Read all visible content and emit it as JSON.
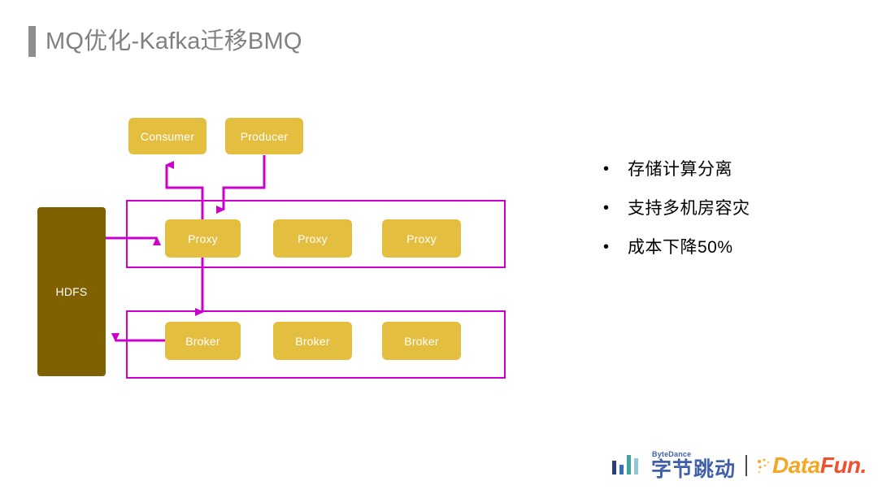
{
  "slide": {
    "title": "MQ优化-Kafka迁移BMQ",
    "accent_color": "#8e8e8e",
    "title_color": "#808080"
  },
  "diagram": {
    "node_color": "#e3be3f",
    "storage_color": "#806000",
    "connector_color": "#cc00cc",
    "nodes": {
      "consumer": "Consumer",
      "producer": "Producer",
      "hdfs": "HDFS",
      "proxy_1": "Proxy",
      "proxy_2": "Proxy",
      "proxy_3": "Proxy",
      "broker_1": "Broker",
      "broker_2": "Broker",
      "broker_3": "Broker"
    }
  },
  "bullets": {
    "marker": "•",
    "items": [
      {
        "text": "存储计算分离"
      },
      {
        "text": "支持多机房容灾"
      },
      {
        "text": "成本下降50%"
      }
    ]
  },
  "footer": {
    "bytedance": {
      "english": "ByteDance",
      "chinese": "字节跳动",
      "bar_colors": [
        "#2b3f7a",
        "#3b6fb5",
        "#3aa79a",
        "#8fc8d8"
      ]
    },
    "divider": "|",
    "datafun": {
      "data": "Data",
      "fun": "Fun.",
      "data_color": "#f5a623",
      "fun_color": "#f1502f"
    }
  }
}
